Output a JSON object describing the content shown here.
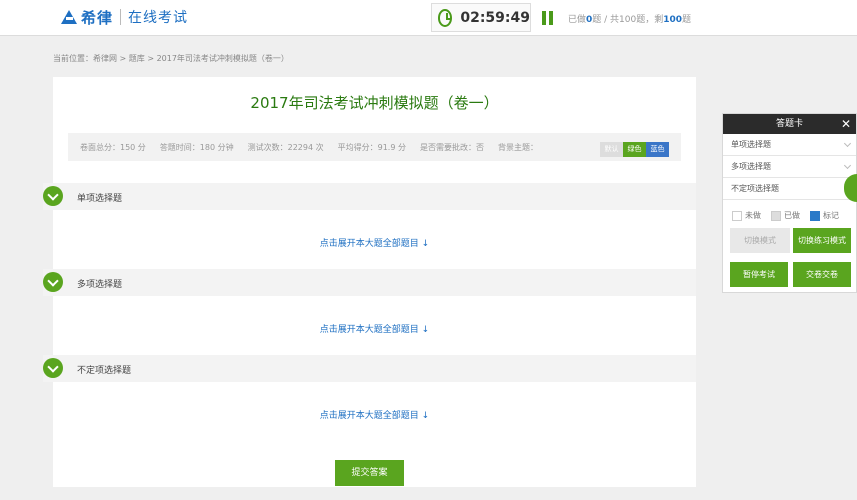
{
  "header": {
    "logo_brand": "希律",
    "logo_sub": "在线考试",
    "timer": "02:59:49",
    "progress": {
      "answered_label": "已做",
      "answered": "0",
      "unit1": "题 / 共",
      "total": "100",
      "unit2": "题，剩",
      "remaining": "100",
      "unit3": "题"
    }
  },
  "breadcrumb": "当前位置：希律网 > 题库 > 2017年司法考试冲刺模拟题（卷一）",
  "exam": {
    "title": "2017年司法考试冲刺模拟题（卷一）",
    "info": {
      "total_score": "卷面总分：150 分",
      "time": "答题时间：180 分钟",
      "attempts": "测试次数：22294 次",
      "avg_score": "平均得分：91.9 分",
      "manual": "是否需要批改：否",
      "theme_label": "背景主题："
    },
    "themes": [
      "默认",
      "绿色",
      "蓝色"
    ]
  },
  "sections": [
    {
      "title": "单项选择题",
      "expand": "点击展开本大题全部题目 ↓"
    },
    {
      "title": "多项选择题",
      "expand": "点击展开本大题全部题目 ↓"
    },
    {
      "title": "不定项选择题",
      "expand": "点击展开本大题全部题目 ↓"
    }
  ],
  "submit_label": "提交答案",
  "answer_card": {
    "title": "答题卡",
    "close": "✕",
    "items": [
      "单项选择题",
      "多项选择题",
      "不定项选择题"
    ],
    "legend": [
      "未做",
      "已做",
      "标记"
    ],
    "buttons": {
      "mode_switch": "切换模式",
      "practice_mode": "切换练习模式",
      "pause": "暂停考试",
      "submit": "交卷交卷"
    }
  },
  "colors": {
    "accent_green": "#5aa51f",
    "brand_blue": "#1e6fc2"
  }
}
